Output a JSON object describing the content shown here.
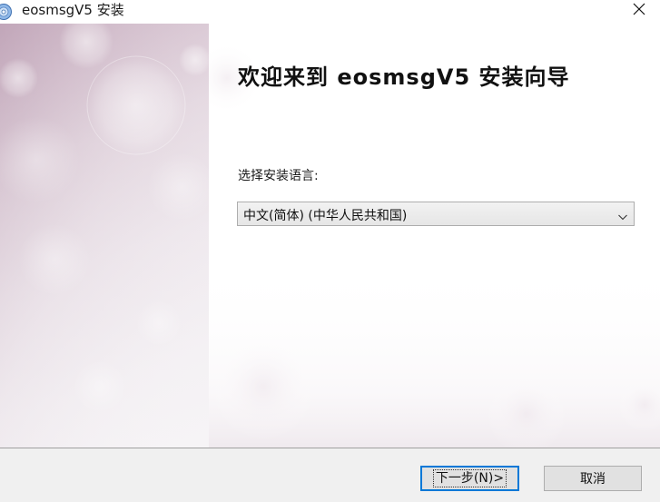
{
  "window": {
    "title": "eosmsgV5 安装",
    "icon": "installer-disc-icon",
    "close_icon": "close-icon"
  },
  "wizard": {
    "heading": "欢迎来到 eosmsgV5 安装向导",
    "language_label": "选择安装语言:",
    "language_selected": "中文(简体) (中华人民共和国)"
  },
  "buttons": {
    "next_label": "下一步(N)>",
    "cancel_label": "取消"
  },
  "colors": {
    "accent": "#0078d7",
    "side_panel_tint": "#cfb8c8",
    "footer_bg": "#f0f0f0"
  }
}
